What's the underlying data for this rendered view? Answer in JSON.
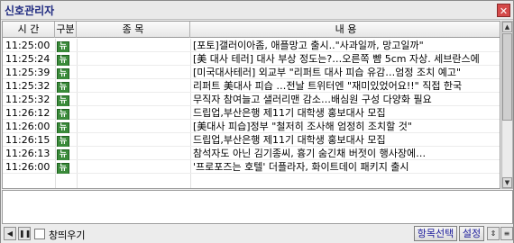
{
  "window": {
    "title": "신호관리자",
    "close_icon": "✕"
  },
  "columns": {
    "time": "시 간",
    "kind": "구분",
    "item": "종 목",
    "content": "내 용"
  },
  "rows": [
    {
      "time": "11:25:00",
      "kind": "뉴",
      "item": "",
      "content": "[포토]갤러이아좀, 애플망고 출시..\"사과일까, 망고일까\""
    },
    {
      "time": "11:25:24",
      "kind": "뉴",
      "item": "",
      "content": "[美 대사 테러] 대사 부상 정도는?…오른쪽 뺨 5cm 자상. 세브란스에"
    },
    {
      "time": "11:25:39",
      "kind": "뉴",
      "item": "",
      "content": "[미국대사테러] 외교부 \"리퍼트 대사 피습 유감…엄정 조치 예고\""
    },
    {
      "time": "11:25:32",
      "kind": "뉴",
      "item": "",
      "content": "리퍼트 美대사 피습 …전날 트위터엔 \"재미있었어요!!\" 직접 한국"
    },
    {
      "time": "11:25:32",
      "kind": "뉴",
      "item": "",
      "content": "무직자 참여늘고 샐러리맨 감소…배심원 구성 다양화 필요"
    },
    {
      "time": "11:26:12",
      "kind": "뉴",
      "item": "",
      "content": "드립업,부산은행 제11기 대학생 홍보대사 모집"
    },
    {
      "time": "11:26:00",
      "kind": "뉴",
      "item": "",
      "content": "[美대사 피습]정부 \"철저히 조사해 엄정히 조치할 것\""
    },
    {
      "time": "11:26:15",
      "kind": "뉴",
      "item": "",
      "content": "드립업,부산은행 제11기 대학생 홍보대사 모집"
    },
    {
      "time": "11:26:13",
      "kind": "뉴",
      "item": "",
      "content": "참석자도 아닌 김기종씨, 흉기 숨긴채 버젓이 행사장에…"
    },
    {
      "time": "11:26:00",
      "kind": "뉴",
      "item": "",
      "content": "'프로포즈는 호텔' 더플라자, 화이트데이 패키지 출시"
    }
  ],
  "scrollbar": {
    "up_icon": "▲",
    "down_icon": "▼"
  },
  "bottom": {
    "prev_icon": "◀",
    "pause_icon": "❚❚",
    "checkbox_label": "창띄우기",
    "select_items_label": "항목선택",
    "settings_label": "설정",
    "updown_icon": "⇕",
    "menu_icon": "≡"
  },
  "colors": {
    "news_badge": "#3a8a3a",
    "title_text": "#1f2a80",
    "button_text": "#1a1a9a"
  }
}
